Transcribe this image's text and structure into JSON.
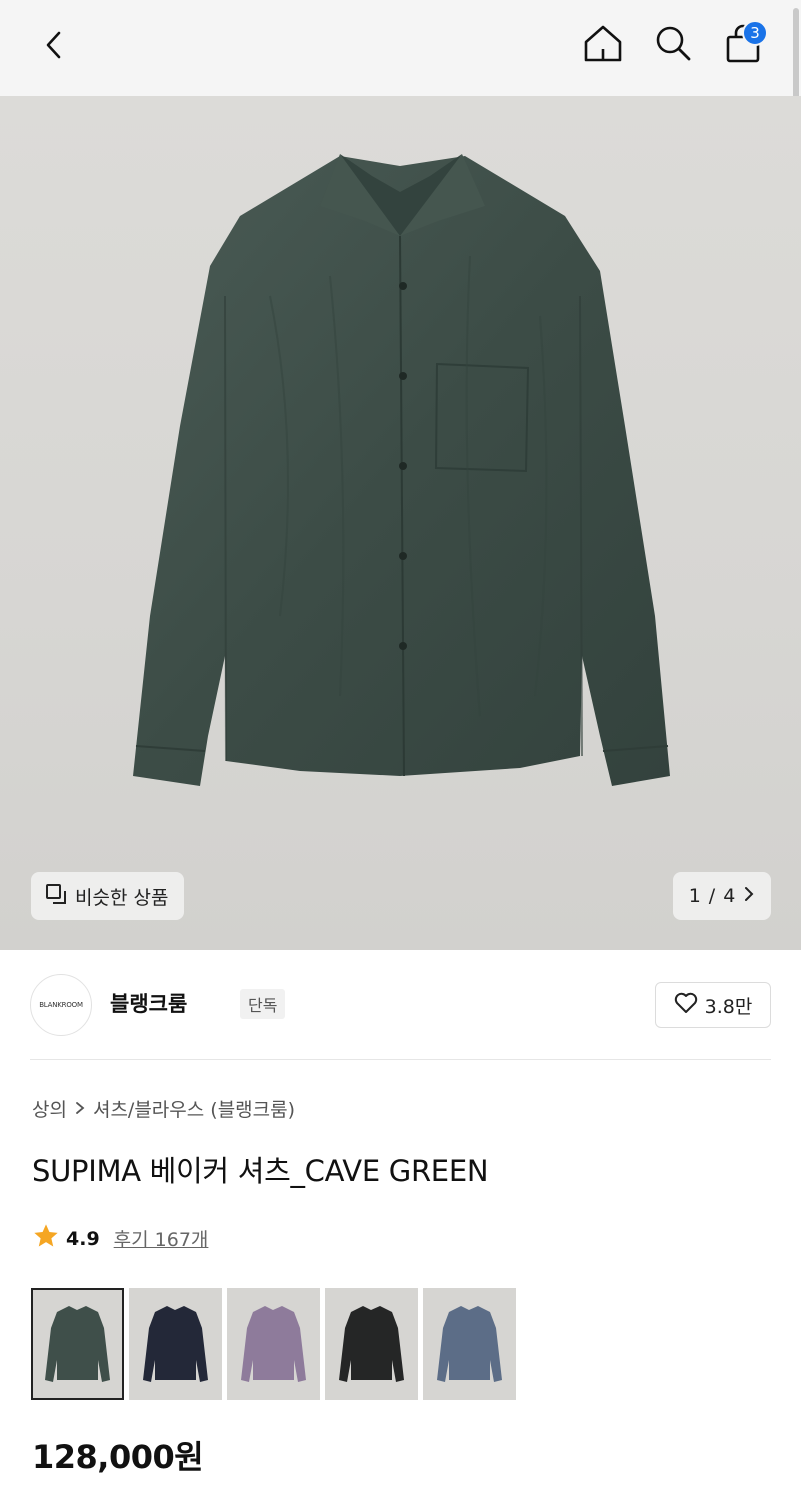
{
  "header": {
    "back_icon": "chevron-left-icon",
    "home_icon": "home-icon",
    "search_icon": "search-icon",
    "cart_icon": "shopping-bag-icon",
    "cart_count": "3",
    "badge_color": "#1a73e8"
  },
  "gallery": {
    "similar_label": "비슷한 상품",
    "similar_icon": "similar-items-icon",
    "page_current": "1",
    "page_sep": "/",
    "page_total": "4",
    "next_icon": "chevron-right-icon",
    "shirt_color": "#3f4f4a"
  },
  "brand": {
    "logo_text": "BLANKROOM",
    "name": "블랭크룸",
    "tag": "단독",
    "likes": "3.8만",
    "like_icon": "heart-icon"
  },
  "product": {
    "breadcrumb": [
      "상의",
      "셔츠/블라우스 (블랭크룸)"
    ],
    "breadcrumb_sep_icon": "chevron-right-icon",
    "title": "SUPIMA 베이커 셔츠_CAVE GREEN",
    "rating": "4.9",
    "rating_icon": "star-icon",
    "star_color": "#f5a623",
    "reviews": "후기 167개",
    "price": "128,000원"
  },
  "color_options": [
    {
      "color_name": "cave-green",
      "hex": "#3f4f4a",
      "selected": true
    },
    {
      "color_name": "navy",
      "hex": "#232838",
      "selected": false
    },
    {
      "color_name": "lavender",
      "hex": "#8e7b9b",
      "selected": false
    },
    {
      "color_name": "black",
      "hex": "#252626",
      "selected": false
    },
    {
      "color_name": "blue-grey",
      "hex": "#5c6d87",
      "selected": false
    }
  ]
}
